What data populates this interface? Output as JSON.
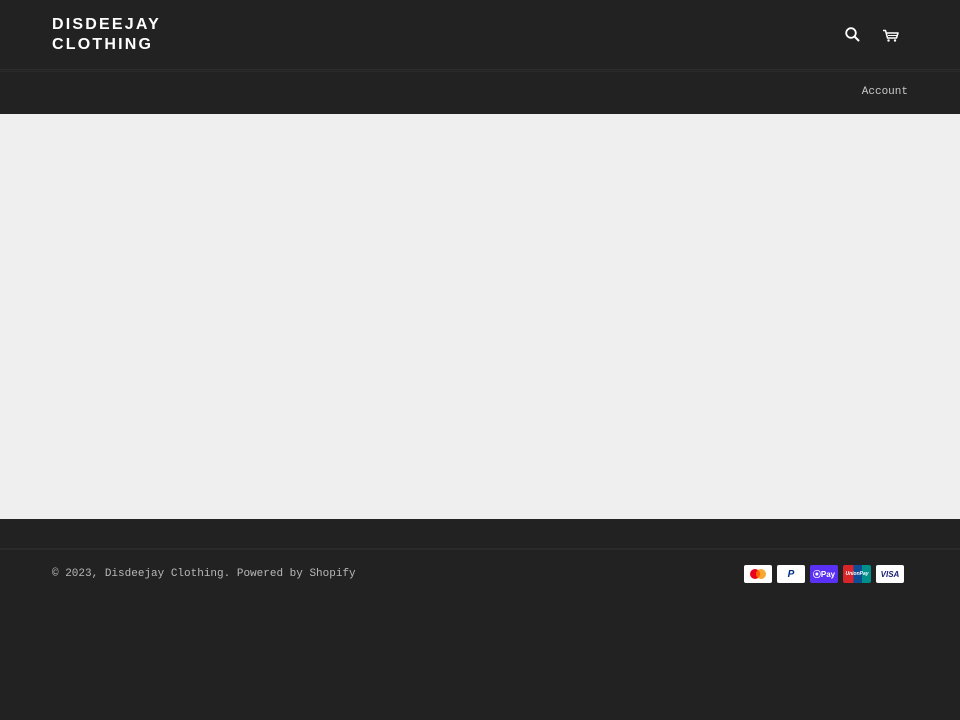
{
  "header": {
    "logo_line1": "DISDEEJAY",
    "logo_line2": "CLOTHING",
    "search_icon": "search-icon",
    "cart_icon": "cart-icon"
  },
  "nav": {
    "account_label": "Account"
  },
  "footer": {
    "copyright_prefix": "© 2023, ",
    "store_name": "Disdeejay Clothing",
    "separator": ". ",
    "powered_by": "Powered by Shopify",
    "payment_methods": [
      {
        "name": "Mastercard",
        "label": ""
      },
      {
        "name": "PayPal",
        "label": "P"
      },
      {
        "name": "Shop Pay",
        "label": "⦿Pay"
      },
      {
        "name": "Union Pay",
        "label": "UnionPay"
      },
      {
        "name": "Visa",
        "label": "VISA"
      }
    ]
  },
  "colors": {
    "header_bg": "#222222",
    "main_bg": "#efefef",
    "shop_pay": "#5a31f4",
    "visa_blue": "#1a1f71"
  }
}
